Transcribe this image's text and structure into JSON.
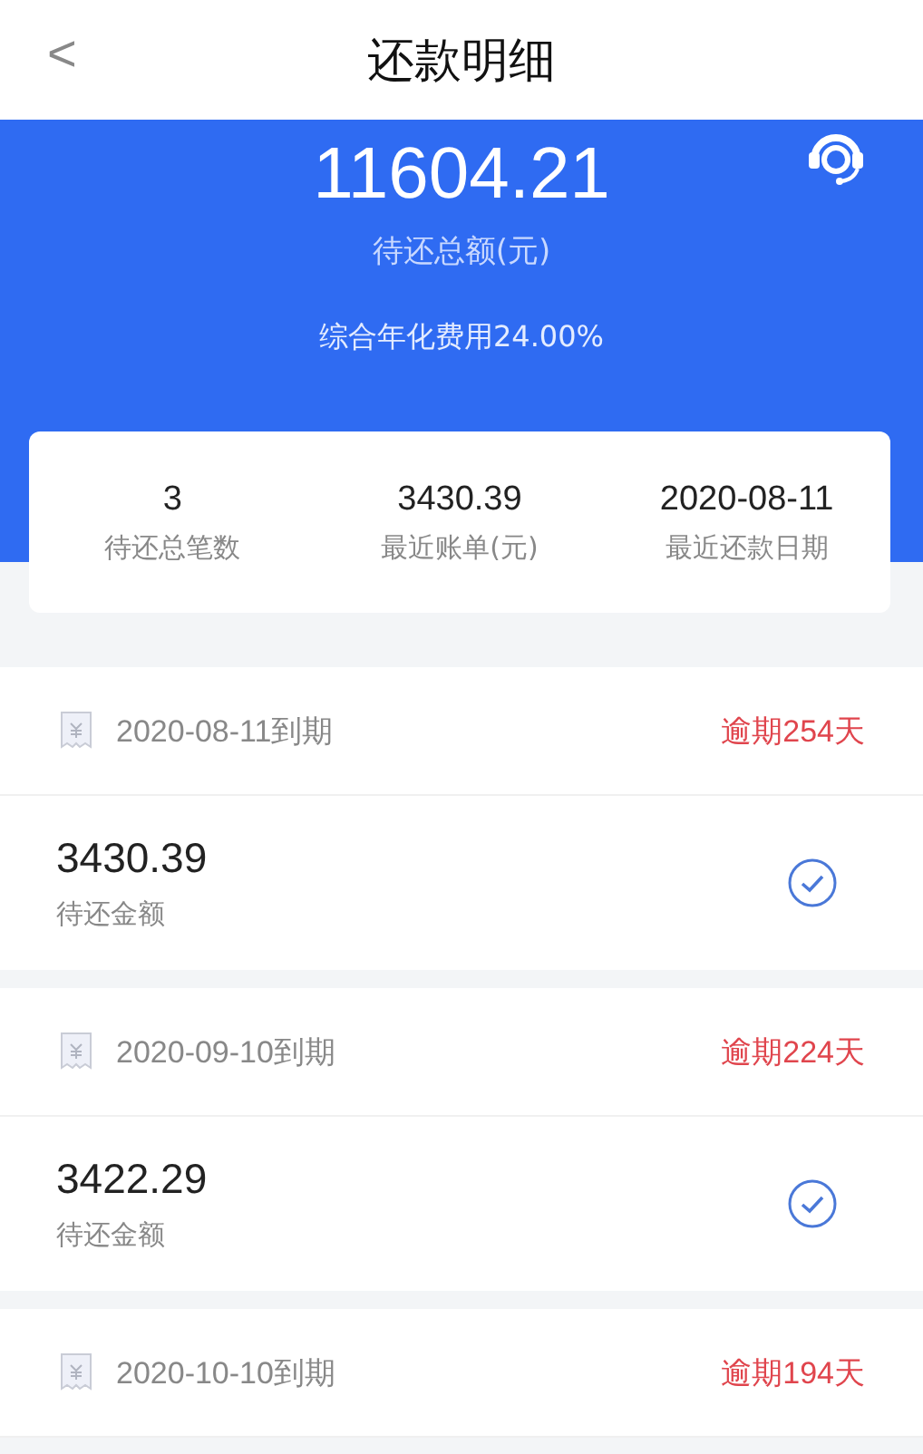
{
  "header": {
    "back": "<",
    "title": "还款明细"
  },
  "summary": {
    "total": "11604.21",
    "total_label": "待还总额(元)",
    "rate": "综合年化费用24.00%"
  },
  "stats": [
    {
      "value": "3",
      "label": "待还总笔数"
    },
    {
      "value": "3430.39",
      "label": "最近账单(元)"
    },
    {
      "value": "2020-08-11",
      "label": "最近还款日期"
    }
  ],
  "bills": [
    {
      "due": "2020-08-11到期",
      "overdue": "逾期254天",
      "amount": "3430.39",
      "amount_label": "待还金额",
      "checked": true
    },
    {
      "due": "2020-09-10到期",
      "overdue": "逾期224天",
      "amount": "3422.29",
      "amount_label": "待还金额",
      "checked": true
    },
    {
      "due": "2020-10-10到期",
      "overdue": "逾期194天"
    }
  ]
}
